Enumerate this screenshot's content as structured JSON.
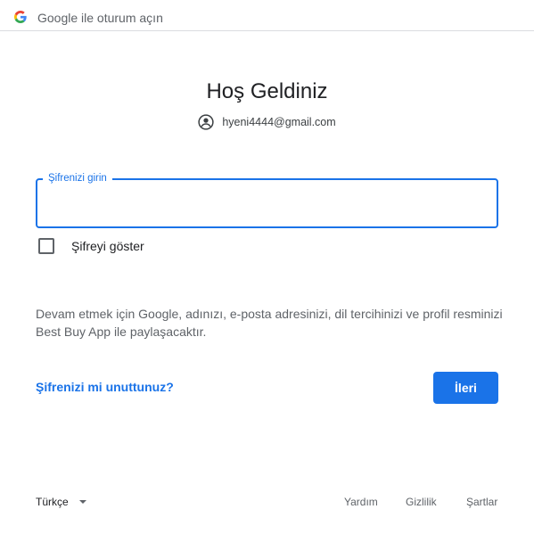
{
  "header": {
    "logo_icon": "google-g-logo",
    "title": "Google ile oturum açın"
  },
  "main": {
    "heading": "Hoş Geldiniz",
    "account": {
      "icon": "account-circle-icon",
      "email": "hyeni4444@gmail.com"
    },
    "password_field": {
      "label": "Şifrenizi girin",
      "value": ""
    },
    "show_password": {
      "label": "Şifreyi göster",
      "checked": false
    },
    "info_text": "Devam etmek için Google, adınızı, e-posta adresinizi, dil tercihinizi ve profil resminizi Best Buy App ile paylaşacaktır.",
    "forgot_link": "Şifrenizi mi unuttunuz?",
    "next_button": "İleri"
  },
  "footer": {
    "language": "Türkçe",
    "help": "Yardım",
    "privacy": "Gizlilik",
    "terms": "Şartlar"
  },
  "colors": {
    "accent": "#1a73e8",
    "text_primary": "#202124",
    "text_secondary": "#5f6368",
    "divider": "#dadce0"
  }
}
